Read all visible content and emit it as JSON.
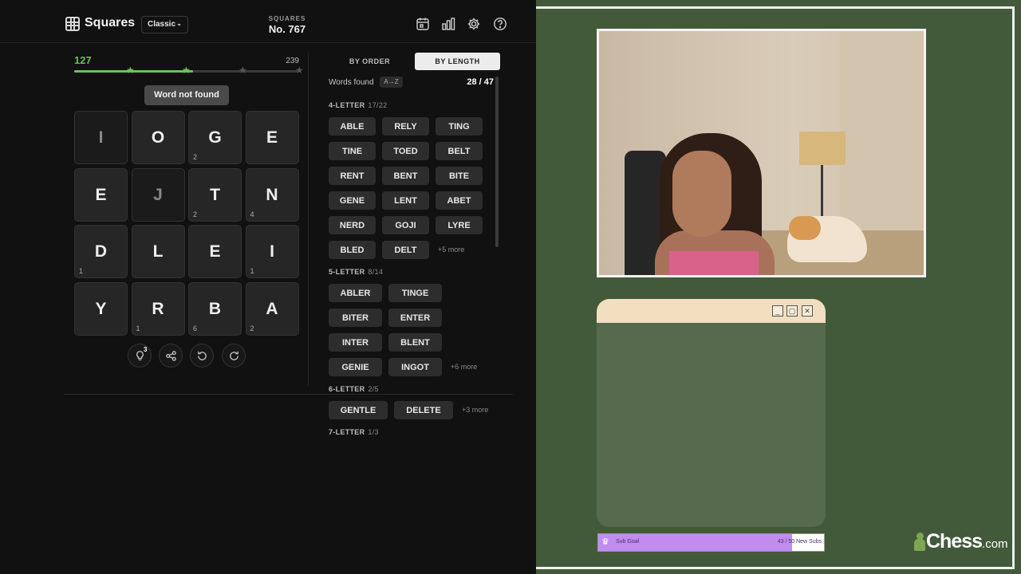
{
  "game": {
    "app_name": "Squares",
    "mode": "Classic",
    "puzzle_label": "SQUARES",
    "puzzle_no": "No. 767",
    "header_icons": [
      "calendar-icon",
      "stats-icon",
      "settings-icon",
      "help-icon"
    ],
    "score": "127",
    "score_max": "239",
    "progress": 0.53,
    "toast": "Word not found",
    "grid": [
      {
        "letter": "I",
        "count": "",
        "dim": true
      },
      {
        "letter": "O",
        "count": "",
        "dim": false
      },
      {
        "letter": "G",
        "count": "2",
        "dim": false
      },
      {
        "letter": "E",
        "count": "",
        "dim": false
      },
      {
        "letter": "E",
        "count": "",
        "dim": false
      },
      {
        "letter": "J",
        "count": "",
        "dim": true
      },
      {
        "letter": "T",
        "count": "2",
        "dim": false
      },
      {
        "letter": "N",
        "count": "4",
        "dim": false
      },
      {
        "letter": "D",
        "count": "1",
        "dim": false
      },
      {
        "letter": "L",
        "count": "",
        "dim": false
      },
      {
        "letter": "E",
        "count": "",
        "dim": false
      },
      {
        "letter": "I",
        "count": "1",
        "dim": false
      },
      {
        "letter": "Y",
        "count": "",
        "dim": false
      },
      {
        "letter": "R",
        "count": "1",
        "dim": false
      },
      {
        "letter": "B",
        "count": "6",
        "dim": false
      },
      {
        "letter": "A",
        "count": "2",
        "dim": false
      }
    ],
    "controls": {
      "hint_count": "3"
    }
  },
  "words": {
    "tab_order": "BY ORDER",
    "tab_length": "BY LENGTH",
    "found_label": "Words found",
    "sort_label": "A→Z",
    "found_count": "28 / 47",
    "groups": [
      {
        "title": "4-LETTER",
        "frac": "17/22",
        "more": "+5 more",
        "words": [
          "ABLE",
          "RELY",
          "TING",
          "TINE",
          "TOED",
          "BELT",
          "RENT",
          "BENT",
          "BITE",
          "GENE",
          "LENT",
          "ABET",
          "NERD",
          "GOJI",
          "LYRE",
          "BLED",
          "DELT"
        ]
      },
      {
        "title": "5-LETTER",
        "frac": "8/14",
        "more": "+6 more",
        "words": [
          "ABLER",
          "TINGE",
          "BITER",
          "ENTER",
          "INTER",
          "BLENT",
          "GENIE",
          "INGOT"
        ]
      },
      {
        "title": "6-LETTER",
        "frac": "2/5",
        "more": "+3 more",
        "words": [
          "GENTLE",
          "DELETE"
        ]
      },
      {
        "title": "7-LETTER",
        "frac": "1/3",
        "more": "",
        "words": []
      }
    ]
  },
  "overlay": {
    "sub_goal_label": "Sub Goal",
    "sub_goal_value": "43 / 50 New Subs",
    "sub_goal_progress": 0.86,
    "brand": "Chess",
    "brand_domain": ".com",
    "accent_green": "#6cbf5b",
    "goal_color": "#c28bf0"
  }
}
